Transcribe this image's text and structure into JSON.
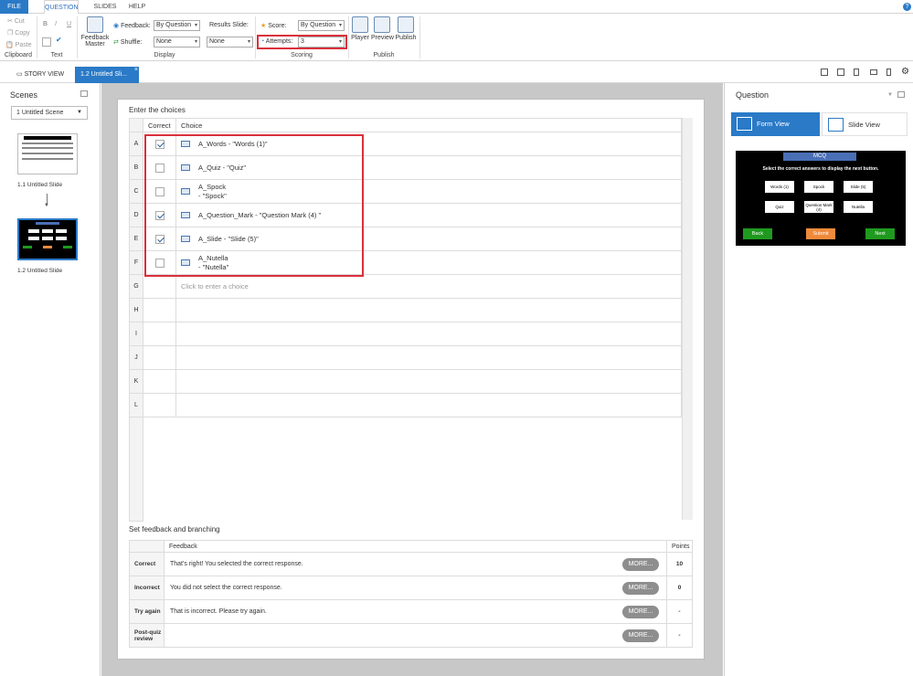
{
  "ribbon": {
    "tabs": [
      "FILE",
      "QUESTION",
      "SLIDES",
      "HELP"
    ],
    "clipboard": {
      "cut": "Cut",
      "copy": "Copy",
      "paste": "Paste",
      "label": "Clipboard"
    },
    "text": {
      "bold": "B",
      "italic": "I",
      "underline": "U",
      "label": "Text"
    },
    "display": {
      "feedback_master": "Feedback Master",
      "feedback_label": "Feedback:",
      "feedback_value": "By Question",
      "shuffle_label": "Shuffle:",
      "shuffle_value": "None",
      "results_label": "Results Slide:",
      "results_value": "None",
      "label": "Display"
    },
    "scoring": {
      "score_label": "Score:",
      "score_value": "By Question",
      "attempts_label": "Attempts:",
      "attempts_value": "3",
      "label": "Scoring"
    },
    "publish": {
      "player": "Player",
      "preview": "Preview",
      "publish": "Publish",
      "label": "Publish"
    }
  },
  "viewbar": {
    "story_view": "STORY VIEW",
    "slide_tab": "1.2 Untitled Sli..."
  },
  "scenes": {
    "title": "Scenes",
    "selector": "1 Untitled Scene",
    "slides": [
      {
        "label": "1.1 Untitled Slide"
      },
      {
        "label": "1.2 Untitled Slide"
      }
    ]
  },
  "editor": {
    "choices_title": "Enter the choices",
    "col_correct": "Correct",
    "col_choice": "Choice",
    "choices": [
      {
        "letter": "A",
        "correct": true,
        "text": "A_Words - \"Words (1)\""
      },
      {
        "letter": "B",
        "correct": false,
        "text": "A_Quiz - \"Quiz\""
      },
      {
        "letter": "C",
        "correct": false,
        "text": "A_Spock\n  - \"Spock\""
      },
      {
        "letter": "D",
        "correct": true,
        "text": "A_Question_Mark - \"Question Mark (4) \""
      },
      {
        "letter": "E",
        "correct": true,
        "text": "A_Slide - \"Slide (5)\""
      },
      {
        "letter": "F",
        "correct": false,
        "text": "A_Nutella\n  - \"Nutella\""
      }
    ],
    "empty_rows": [
      "G",
      "H",
      "I",
      "J",
      "K",
      "L"
    ],
    "placeholder": "Click to enter a choice",
    "feedback_title": "Set feedback and branching",
    "col_feedback": "Feedback",
    "col_points": "Points",
    "feedback_rows": [
      {
        "type": "Correct",
        "text": "That's right!  You selected the correct response.",
        "points": "10"
      },
      {
        "type": "Incorrect",
        "text": "You did not select the correct response.",
        "points": "0"
      },
      {
        "type": "Try again",
        "text": "That is incorrect. Please try again.",
        "points": "-"
      },
      {
        "type": "Post-quiz review",
        "text": "",
        "points": "-"
      }
    ],
    "more_label": "MORE..."
  },
  "question_panel": {
    "title": "Question",
    "form_view": "Form View",
    "slide_view": "Slide View",
    "preview": {
      "title": "MCQ",
      "instruction": "Select the correct answers to display the next button.",
      "options": [
        "Words (1)",
        "Spock",
        "Slide (5)",
        "Quiz",
        "Question Mark (4)",
        "Nutella"
      ],
      "back": "Back",
      "submit": "Submit",
      "next": "Next"
    }
  },
  "colors": {
    "accent": "#2a7ac7",
    "highlight": "#d9303a",
    "back_btn": "#1f9a1f",
    "submit_btn": "#f08a3c"
  }
}
